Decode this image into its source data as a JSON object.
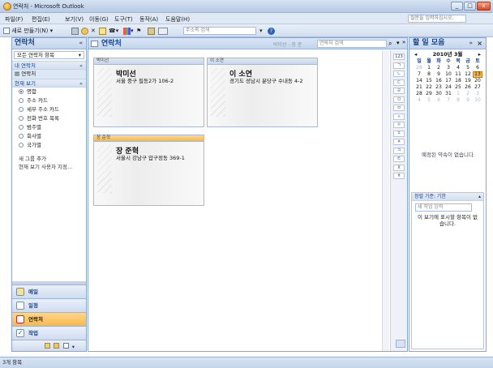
{
  "window": {
    "title": "연락처 - Microsoft Outlook",
    "minimize": "_",
    "maximize": "□",
    "close": "x"
  },
  "menu": {
    "items": [
      "파일(F)",
      "편집(E)",
      "보기(V)",
      "이동(G)",
      "도구(T)",
      "동작(A)",
      "도움말(H)"
    ],
    "help_placeholder": "질문을 입력하십시오."
  },
  "toolbar": {
    "new_label": "새로 만들기(N)",
    "address_book_placeholder": "주소록 검색"
  },
  "nav": {
    "title": "연락처",
    "collapse": "«",
    "all_contacts_dropdown": "모든 연락처 항목",
    "my_contacts_header": "내 연락처",
    "my_contacts_item": "연락처",
    "current_view_header": "현재 보기",
    "views": [
      {
        "label": "명함",
        "selected": true
      },
      {
        "label": "주소 카드",
        "selected": false
      },
      {
        "label": "세부 주소 카드",
        "selected": false
      },
      {
        "label": "전화 번호 목록",
        "selected": false
      },
      {
        "label": "범주별",
        "selected": false
      },
      {
        "label": "회사별",
        "selected": false
      },
      {
        "label": "국가별",
        "selected": false
      }
    ],
    "add_group": "새 그룹 추가",
    "customize_view": "현재 보기 사용자 지정...",
    "buttons": [
      {
        "label": "메일",
        "active": false
      },
      {
        "label": "일정",
        "active": false
      },
      {
        "label": "연락처",
        "active": true
      },
      {
        "label": "작업",
        "active": false
      }
    ]
  },
  "main": {
    "title": "연락처",
    "range": "박미선 - 장 준",
    "search_placeholder": "연락처 검색",
    "cards": [
      {
        "head": "박미선",
        "name": "박미선",
        "address": "서울 중구 필동2가 106-2",
        "selected": false
      },
      {
        "head": "이 소연",
        "name": "이 소연",
        "address": "경기도 성남시 분당구 수내동 4-2",
        "selected": false
      },
      {
        "head": "장 준혁",
        "name": "장 준혁",
        "address": "서울시 강남구 압구정동 369-1",
        "selected": true
      }
    ],
    "alpha_index": [
      "123",
      "ㄱ",
      "ㄴ",
      "ㄷ",
      "ㄹ",
      "ㅁ",
      "ㅂ",
      "ㅅ",
      "ㅇ",
      "ㅈ",
      "ㅊ",
      "ㅋ",
      "ㅌ",
      "ㅍ",
      "ㅎ"
    ]
  },
  "todo": {
    "title": "할 일 모음",
    "calendar": {
      "title": "2010년 3월",
      "weekdays": [
        "일",
        "월",
        "화",
        "수",
        "목",
        "금",
        "토"
      ],
      "days": [
        "28",
        "1",
        "2",
        "3",
        "4",
        "5",
        "6",
        "7",
        "8",
        "9",
        "10",
        "11",
        "12",
        "13",
        "14",
        "15",
        "16",
        "17",
        "18",
        "19",
        "20",
        "21",
        "22",
        "23",
        "24",
        "25",
        "26",
        "27",
        "28",
        "29",
        "30",
        "31",
        "1",
        "2",
        "3",
        "4",
        "5",
        "6",
        "7",
        "8",
        "9",
        "10"
      ],
      "dim_indices": [
        0,
        32,
        33,
        34,
        35,
        36,
        37,
        38,
        39,
        40,
        41
      ],
      "today_index": 13
    },
    "no_appointments": "예정된 약속이 없습니다.",
    "task_sort": "정렬 기준: 기한",
    "task_input_placeholder": "새 작업 입력",
    "task_empty": "이 보기에 표시할 항목이 없습니다."
  },
  "status": {
    "count": "3개 항목"
  },
  "colors": {
    "accent": "#15428b",
    "selected": "#f7b54a"
  }
}
